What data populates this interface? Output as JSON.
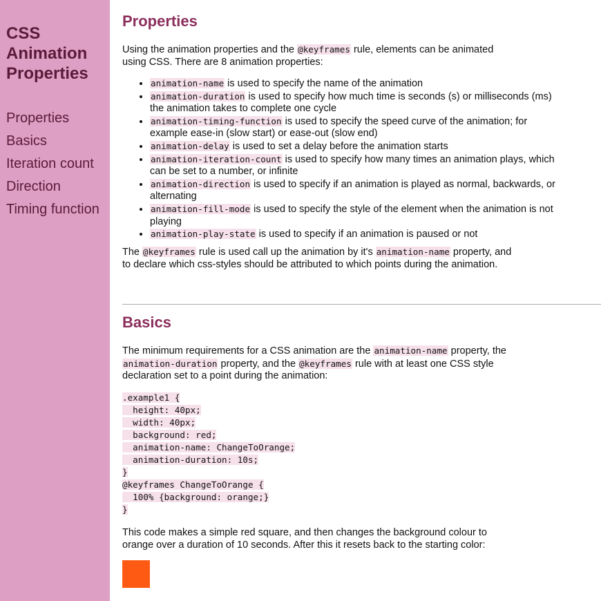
{
  "sidebar": {
    "title_lines": [
      "CSS",
      "Animation",
      "Properties"
    ],
    "nav": [
      "Properties",
      "Basics",
      "Iteration count",
      "Direction",
      "Timing function"
    ]
  },
  "properties": {
    "heading": "Properties",
    "intro": {
      "before": "Using the animation properties and the ",
      "code": "@keyframes",
      "after": " rule, elements can be animated using CSS. There are 8 animation properties:"
    },
    "items": [
      {
        "code": "animation-name",
        "text": " is used to specify the name of the animation"
      },
      {
        "code": "animation-duration",
        "text": " is used to specify how much time is seconds (s) or milliseconds (ms) the animation takes to complete one cycle"
      },
      {
        "code": "animation-timing-function",
        "text": " is used to specify the speed curve of the animation; for example ease-in (slow start) or ease-out (slow end)"
      },
      {
        "code": "animation-delay",
        "text": " is used to set a delay before the animation starts"
      },
      {
        "code": "animation-iteration-count",
        "text": " is used to specify how many times an animation plays, which can be set to a number, or infinite"
      },
      {
        "code": "animation-direction",
        "text": " is used to specify if an animation is played as normal, backwards, or alternating"
      },
      {
        "code": "animation-fill-mode",
        "text": " is used to specify the style of the element when the animation is not playing"
      },
      {
        "code": "animation-play-state",
        "text": " is used to specify if an animation is paused or not"
      }
    ],
    "outro": {
      "t1": "The ",
      "c1": "@keyframes",
      "t2": " rule is used call up the animation by it's ",
      "c2": "animation-name",
      "t3": " property, and to declare which css-styles should be attributed to which points during the animation."
    }
  },
  "basics": {
    "heading": "Basics",
    "intro": {
      "t1": "The minimum requirements for a CSS animation are the ",
      "c1": "animation-name",
      "t2": " property, the ",
      "c2": "animation-duration",
      "t3": " property, and the ",
      "c3": "@keyframes",
      "t4": " rule with at least one CSS style declaration set to a point during the animation:"
    },
    "code_lines": [
      ".example1 {",
      "  height: 40px;",
      "  width: 40px;",
      "  background: red;",
      "  animation-name: ChangeToOrange;",
      "  animation-duration: 10s;",
      "}",
      "@keyframes ChangeToOrange {",
      "  100% {background: orange;}",
      "}"
    ],
    "outro": "This code makes a simple red square, and then changes the background colour to orange over a duration of 10 seconds. After this it resets back to the starting color:",
    "demo_color": "#ff5a14"
  }
}
